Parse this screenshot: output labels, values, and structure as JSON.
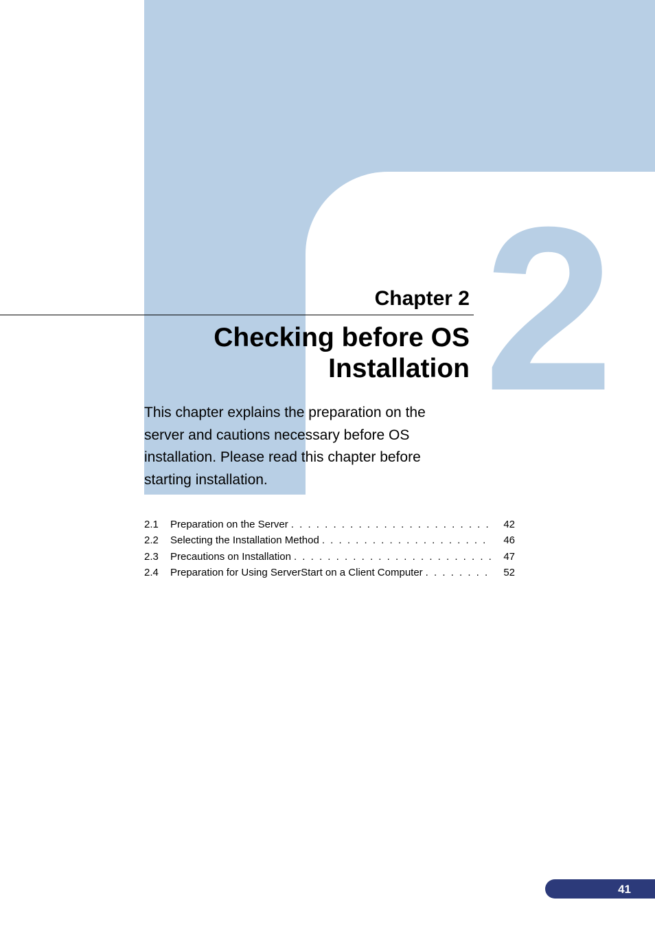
{
  "chapter": {
    "label": "Chapter 2",
    "big_number": "2",
    "title": "Checking before OS Installation",
    "intro": "This chapter explains the preparation on the server and cautions necessary before OS installation. Please read this chapter before starting installation."
  },
  "toc": [
    {
      "num": "2.1",
      "title": "Preparation on the Server",
      "page": "42"
    },
    {
      "num": "2.2",
      "title": "Selecting the Installation Method",
      "page": "46"
    },
    {
      "num": "2.3",
      "title": "Precautions on Installation",
      "page": "47"
    },
    {
      "num": "2.4",
      "title": "Preparation for Using ServerStart on a Client Computer",
      "page": "52"
    }
  ],
  "page_number": "41"
}
